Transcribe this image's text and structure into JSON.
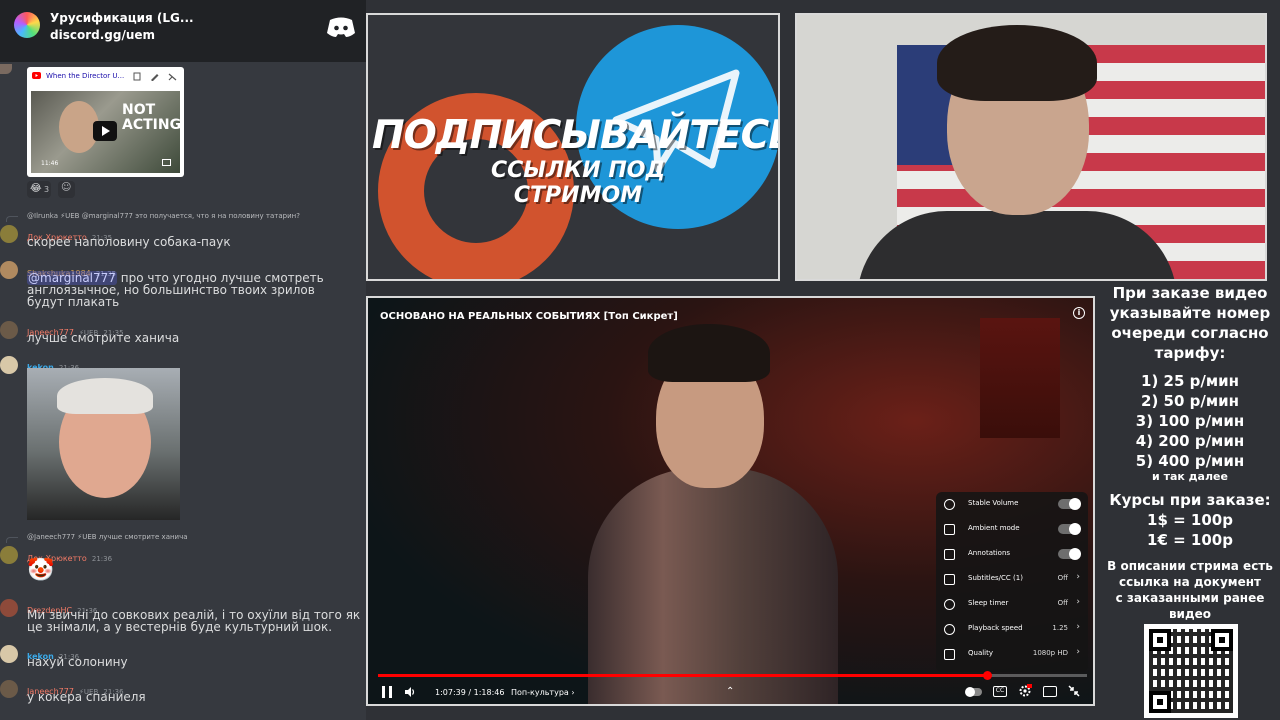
{
  "server": {
    "name": "Урусификация (LG...",
    "invite": "discord.gg/uem"
  },
  "embed": {
    "title": "When the Director U...",
    "thumb_text_1": "NOT",
    "thumb_text_2": "ACTING",
    "duration": "11:46",
    "reaction_count": "3"
  },
  "messages": [
    {
      "reply": "@Ilrunka ⚡UEB @marginal777 это получается, что я на половину татарин?",
      "user": "Док Хрюкетто",
      "user_color": "#f47b67",
      "time": "21:35",
      "text": "скорее наполовину собака-паук",
      "mention": ""
    },
    {
      "reply": "",
      "user": "Shakshuka1984",
      "user_color": "#c99a57",
      "time": "21:35",
      "text": "про что угодно лучше смотреть англоязычное, но большинство твоих зрилов будут плакать",
      "mention": "@marginal777"
    },
    {
      "reply": "",
      "user": "Janeech777",
      "user_color": "#f47b67",
      "time": "21:35",
      "text": "лучше смотрите ханича",
      "mention": ""
    },
    {
      "reply": "",
      "user": "kekon",
      "user_color": "#3ba9e8",
      "time": "21:36",
      "text": "",
      "mention": ""
    },
    {
      "reply": "@Janeech777 ⚡UEB лучше смотрите ханича",
      "user": "Док Хрюкетто",
      "user_color": "#f47b67",
      "time": "21:36",
      "text": "🤡",
      "mention": ""
    },
    {
      "reply": "",
      "user": "DrezdenHC",
      "user_color": "#f47b67",
      "time": "21:36",
      "text": "Ми звичні до совкових реалій, і то охуїли від того як це знімали, а у вестернів буде культурний шок.",
      "mention": ""
    },
    {
      "reply": "",
      "user": "kekon",
      "user_color": "#3ba9e8",
      "time": "21:36",
      "text": "нахуй солонину",
      "mention": ""
    },
    {
      "reply": "",
      "user": "Janeech777",
      "user_color": "#f47b67",
      "time": "21:36",
      "text": "у кокера спаниеля",
      "mention": ""
    }
  ],
  "badge_ueb": "⚡UEB",
  "promo": {
    "line1": "ПОДПИСЫВАЙТЕСЬ",
    "line2": "ССЫЛКИ ПОД СТРИМОМ"
  },
  "player": {
    "title": "ОСНОВАНО НА РЕАЛЬНЫХ СОБЫТИЯХ [Топ Сикрет]",
    "time": "1:07:39 / 1:18:46",
    "chapter": "Поп-культура",
    "progress": 0.8587,
    "settings": [
      {
        "icon": "stable-volume-icon",
        "label": "Stable Volume",
        "value": "",
        "toggle": true
      },
      {
        "icon": "ambient-mode-icon",
        "label": "Ambient mode",
        "value": "",
        "toggle": true
      },
      {
        "icon": "annotations-icon",
        "label": "Annotations",
        "value": "",
        "toggle": true
      },
      {
        "icon": "subtitles-icon",
        "label": "Subtitles/CC (1)",
        "value": "Off",
        "toggle": false
      },
      {
        "icon": "sleep-timer-icon",
        "label": "Sleep timer",
        "value": "Off",
        "toggle": false
      },
      {
        "icon": "playback-speed-icon",
        "label": "Playback speed",
        "value": "1.25",
        "toggle": false
      },
      {
        "icon": "quality-icon",
        "label": "Quality",
        "value": "1080p HD",
        "toggle": false
      }
    ],
    "cc_label": "CC"
  },
  "info": {
    "lines": [
      "При заказе видео",
      "указывайте номер",
      "очереди согласно",
      "тарифу:",
      "1) 25 р/мин",
      "2) 50 р/мин",
      "3) 100 р/мин",
      "4) 200 р/мин",
      "5) 400 р/мин",
      "и так далее",
      "Курсы при заказе:",
      "1$ = 100р",
      "1€ = 100р",
      "В описании стрима есть",
      "ссылка на документ",
      "с заказанными ранее",
      "видео"
    ]
  },
  "colors": {
    "discord_bg": "#36393f",
    "progress_red": "#ff0000",
    "telegram_blue": "#1e96d8",
    "boosty_orange": "#d1532e"
  }
}
